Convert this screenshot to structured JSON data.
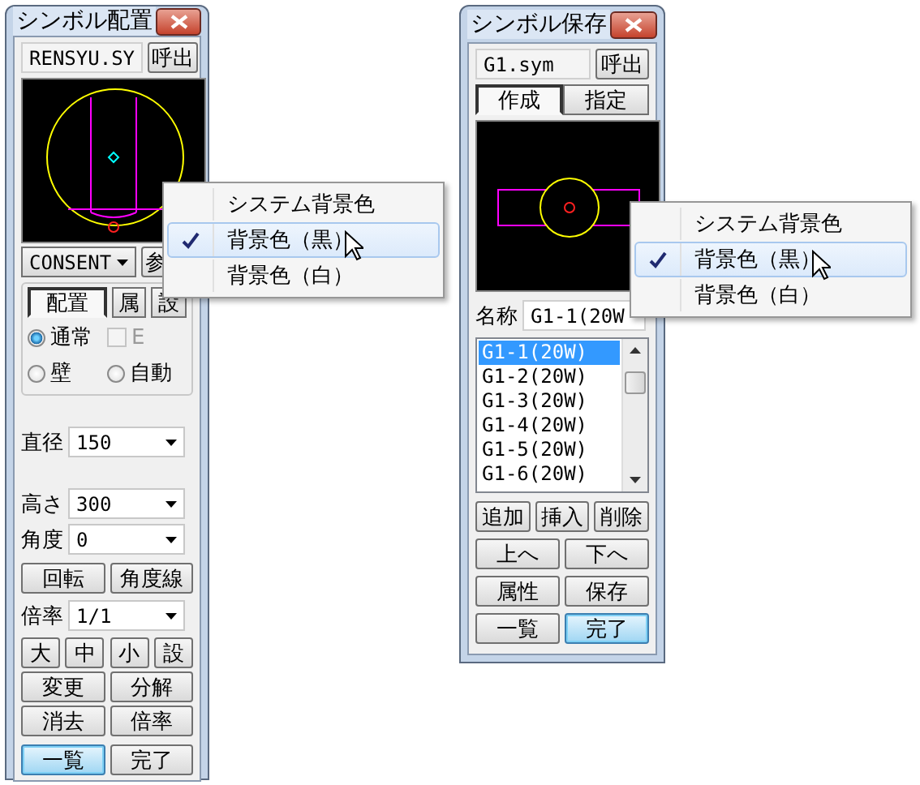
{
  "placement_window": {
    "title": "シンボル配置",
    "file_name": "RENSYU.SY",
    "load_button": "呼出",
    "symbol_dropdown": "CONSENT",
    "side_button": "参",
    "tabs": [
      {
        "label": "配置",
        "selected": true
      },
      {
        "label": "属",
        "selected": false
      },
      {
        "label": "設",
        "selected": false
      }
    ],
    "options": [
      {
        "kind": "radio",
        "label": "通常",
        "checked": true,
        "disabled": false
      },
      {
        "kind": "checkbox",
        "label": "E",
        "checked": false,
        "disabled": true
      },
      {
        "kind": "radio",
        "label": "壁",
        "checked": false,
        "disabled": false
      },
      {
        "kind": "radio",
        "label": "自動",
        "checked": false,
        "disabled": false
      }
    ],
    "diameter": {
      "label": "直径",
      "value": "150"
    },
    "height": {
      "label": "高さ",
      "value": "300"
    },
    "angle": {
      "label": "角度",
      "value": "0"
    },
    "rotate_buttons": [
      {
        "label": "回転",
        "focused": false
      },
      {
        "label": "角度線",
        "focused": false
      }
    ],
    "scale": {
      "label": "倍率",
      "value": "1/1"
    },
    "size_buttons": [
      {
        "label": "大",
        "focused": false
      },
      {
        "label": "中",
        "focused": false
      },
      {
        "label": "小",
        "focused": false
      },
      {
        "label": "設",
        "focused": false
      }
    ],
    "action_rows": [
      [
        {
          "label": "変更",
          "focused": false
        },
        {
          "label": "分解",
          "focused": false
        }
      ],
      [
        {
          "label": "消去",
          "focused": false
        },
        {
          "label": "倍率",
          "focused": false
        }
      ],
      [
        {
          "label": "一覧",
          "focused": true
        },
        {
          "label": "完了",
          "focused": false
        }
      ]
    ]
  },
  "save_window": {
    "title": "シンボル保存",
    "file_name": "G1.sym",
    "load_button": "呼出",
    "tabs": [
      {
        "label": "作成",
        "selected": true
      },
      {
        "label": "指定",
        "selected": false
      }
    ],
    "name_field": {
      "label": "名称",
      "value": "G1-1(20W"
    },
    "list": [
      {
        "label": "G1-1(20W)",
        "selected": true
      },
      {
        "label": "G1-2(20W)",
        "selected": false
      },
      {
        "label": "G1-3(20W)",
        "selected": false
      },
      {
        "label": "G1-4(20W)",
        "selected": false
      },
      {
        "label": "G1-5(20W)",
        "selected": false
      },
      {
        "label": "G1-6(20W)",
        "selected": false
      }
    ],
    "action_rows": [
      [
        {
          "label": "追加",
          "focused": false
        },
        {
          "label": "挿入",
          "focused": false
        },
        {
          "label": "削除",
          "focused": false
        }
      ],
      [
        {
          "label": "上へ",
          "focused": false
        },
        {
          "label": "下へ",
          "focused": false
        }
      ],
      [
        {
          "label": "属性",
          "focused": false
        },
        {
          "label": "保存",
          "focused": false
        }
      ],
      [
        {
          "label": "一覧",
          "focused": false
        },
        {
          "label": "完了",
          "focused": true
        }
      ]
    ]
  },
  "context_menus": [
    {
      "items": [
        {
          "label": "システム背景色",
          "checked": false,
          "selected": false
        },
        {
          "label": "背景色（黒）",
          "checked": true,
          "selected": true
        },
        {
          "label": "背景色（白）",
          "checked": false,
          "selected": false
        }
      ]
    },
    {
      "items": [
        {
          "label": "システム背景色",
          "checked": false,
          "selected": false
        },
        {
          "label": "背景色（黒）",
          "checked": true,
          "selected": true
        },
        {
          "label": "背景色（白）",
          "checked": false,
          "selected": false
        }
      ]
    }
  ]
}
